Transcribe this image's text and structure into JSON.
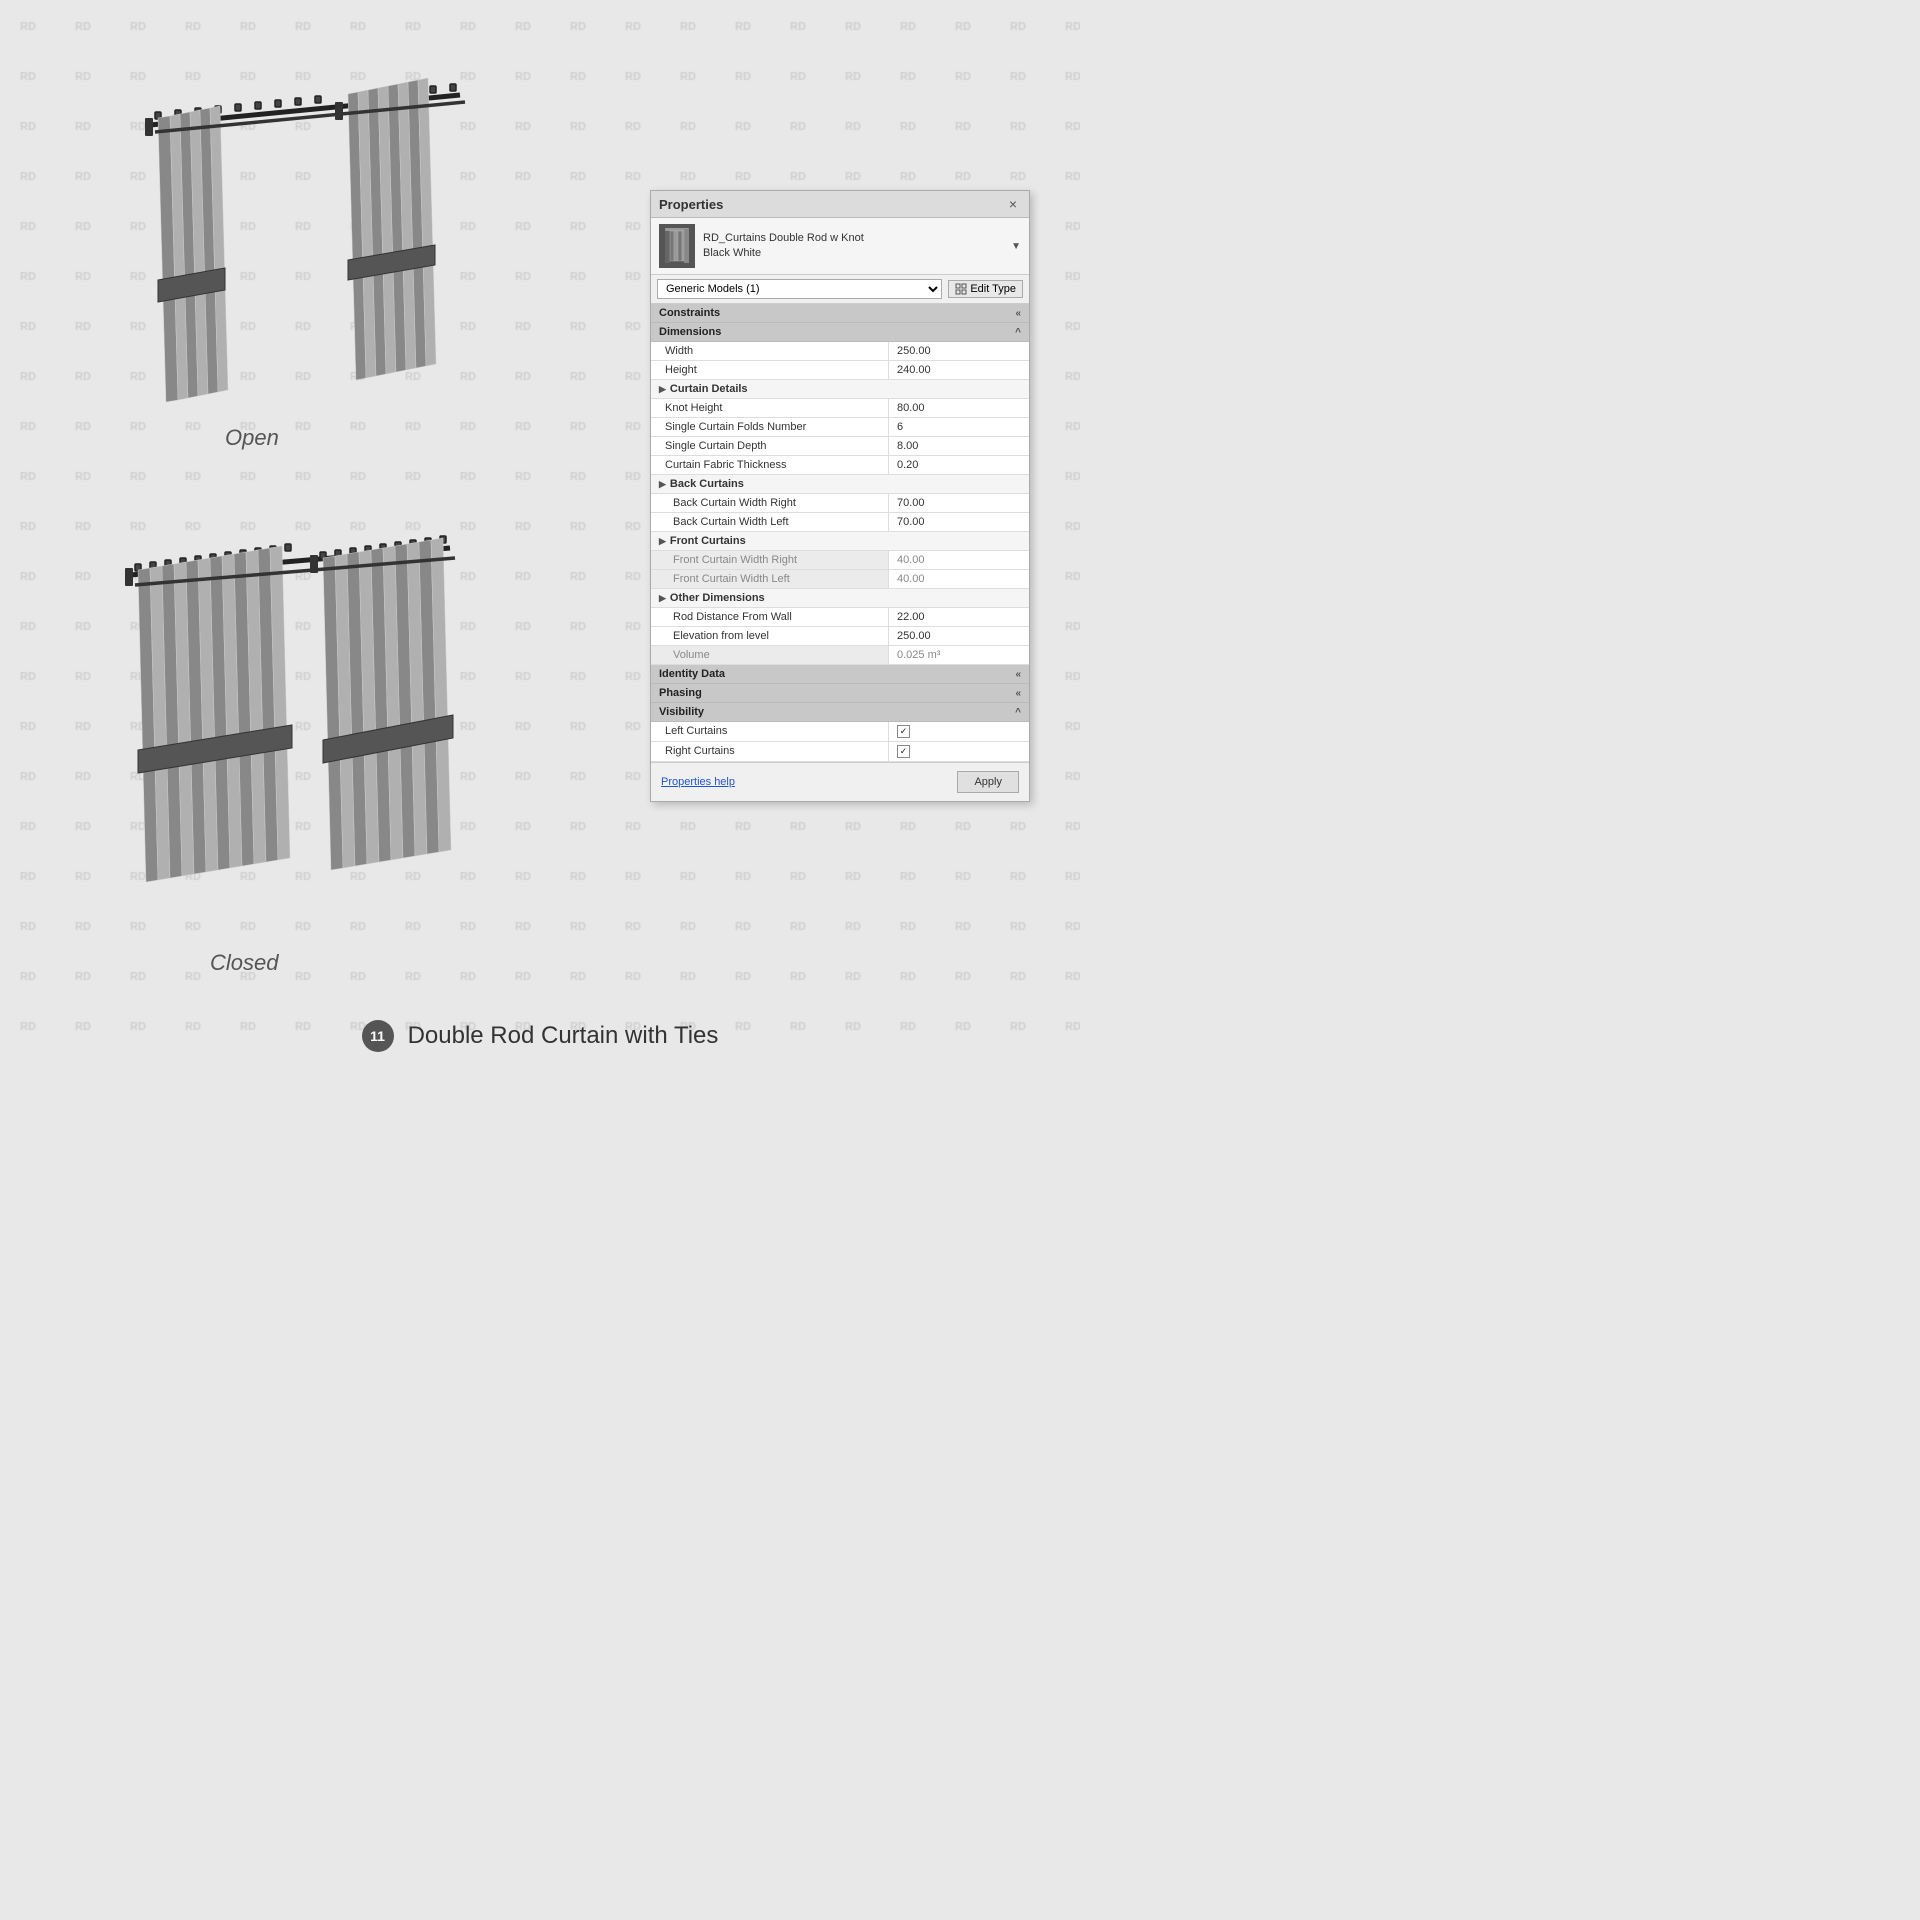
{
  "watermark": {
    "text": "RD"
  },
  "panel": {
    "title": "Properties",
    "close_label": "×",
    "object_name_line1": "RD_Curtains Double Rod w Knot",
    "object_name_line2": "Black White",
    "dropdown_arrow": "▼",
    "type_selector_label": "Generic Models (1)",
    "edit_type_label": "Edit Type",
    "sections": {
      "constraints": {
        "label": "Constraints",
        "toggle": "«"
      },
      "dimensions": {
        "label": "Dimensions",
        "toggle": "^"
      },
      "identity_data": {
        "label": "Identity Data",
        "toggle": "«"
      },
      "phasing": {
        "label": "Phasing",
        "toggle": "«"
      },
      "visibility": {
        "label": "Visibility",
        "toggle": "^"
      }
    },
    "properties": [
      {
        "label": "Width",
        "value": "250.00",
        "indent": false,
        "type": "value"
      },
      {
        "label": "Height",
        "value": "240.00",
        "indent": false,
        "type": "value"
      },
      {
        "label": "▶ Curtain Details",
        "value": "",
        "indent": false,
        "type": "group"
      },
      {
        "label": "Knot Height",
        "value": "80.00",
        "indent": false,
        "type": "value"
      },
      {
        "label": "Single Curtain Folds Number",
        "value": "6",
        "indent": false,
        "type": "value"
      },
      {
        "label": "Single Curtain Depth",
        "value": "8.00",
        "indent": false,
        "type": "value"
      },
      {
        "label": "Curtain Fabric Thickness",
        "value": "0.20",
        "indent": false,
        "type": "value"
      },
      {
        "label": "▶ Back Curtains",
        "value": "",
        "indent": false,
        "type": "group"
      },
      {
        "label": "Back Curtain Width Right",
        "value": "70.00",
        "indent": true,
        "type": "value"
      },
      {
        "label": "Back Curtain Width Left",
        "value": "70.00",
        "indent": true,
        "type": "value"
      },
      {
        "label": "▶ Front Curtains",
        "value": "",
        "indent": false,
        "type": "group"
      },
      {
        "label": "Front Curtain Width Right",
        "value": "40.00",
        "indent": true,
        "type": "value"
      },
      {
        "label": "Front Curtain Width Left",
        "value": "40.00",
        "indent": true,
        "type": "value"
      },
      {
        "label": "▶ Other Dimensions",
        "value": "",
        "indent": false,
        "type": "group"
      },
      {
        "label": "Rod Distance From Wall",
        "value": "22.00",
        "indent": true,
        "type": "value"
      },
      {
        "label": "Elevation from level",
        "value": "250.00",
        "indent": true,
        "type": "value"
      },
      {
        "label": "Volume",
        "value": "0.025 m³",
        "indent": true,
        "type": "value"
      }
    ],
    "visibility_props": [
      {
        "label": "Left Curtains",
        "checked": true
      },
      {
        "label": "Right Curtains",
        "checked": true
      }
    ],
    "footer": {
      "help_link": "Properties help",
      "apply_button": "Apply"
    }
  },
  "labels": {
    "open": "Open",
    "closed": "Closed"
  },
  "bottom": {
    "number": "11",
    "title": "Double Rod Curtain with Ties"
  }
}
